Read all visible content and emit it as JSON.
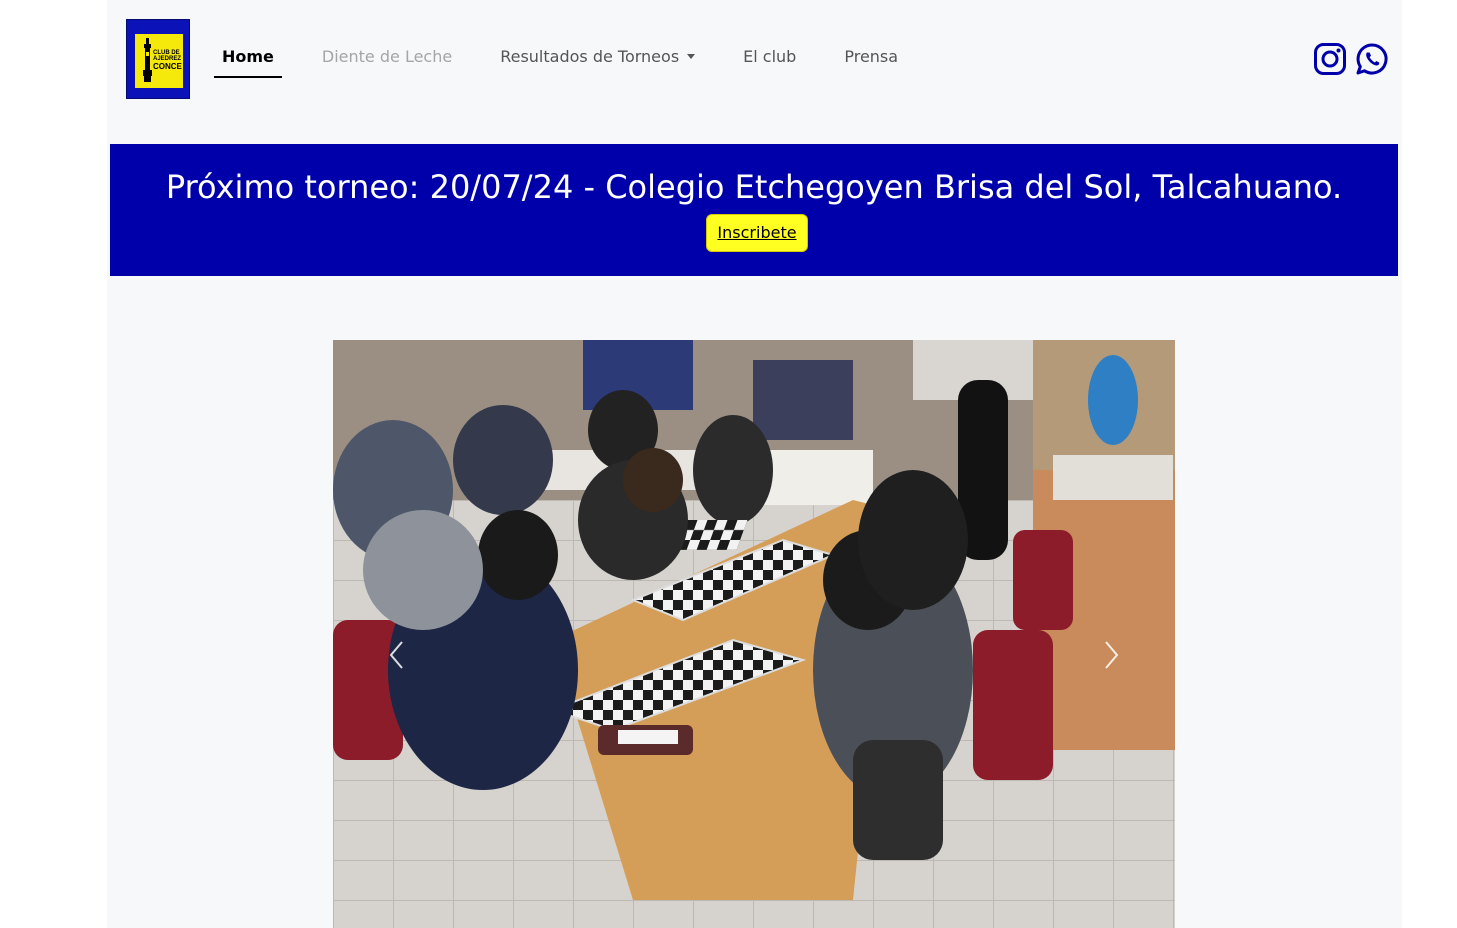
{
  "brand": {
    "logo_text": [
      "CLUB DE",
      "AJEDREZ",
      "CONCE"
    ],
    "colors": {
      "primary": "#0b12b8",
      "accent": "#f5e80b"
    }
  },
  "nav": {
    "items": [
      {
        "label": "Home",
        "state": "active"
      },
      {
        "label": "Diente de Leche",
        "state": "disabled"
      },
      {
        "label": "Resultados de Torneos",
        "state": "dropdown"
      },
      {
        "label": "El club",
        "state": "normal"
      },
      {
        "label": "Prensa",
        "state": "normal"
      }
    ]
  },
  "social": {
    "icons": [
      "instagram-icon",
      "whatsapp-icon"
    ],
    "color": "#0000aa"
  },
  "banner": {
    "title": "Próximo torneo: 20/07/24 - Colegio Etchegoyen Brisa del Sol, Talcahuano.",
    "button_label": "Inscribete",
    "background": "#0000aa",
    "button_color": "#ffff22"
  },
  "carousel": {
    "slide": "chess-tournament-photo",
    "controls": [
      "previous-icon",
      "next-icon"
    ]
  }
}
